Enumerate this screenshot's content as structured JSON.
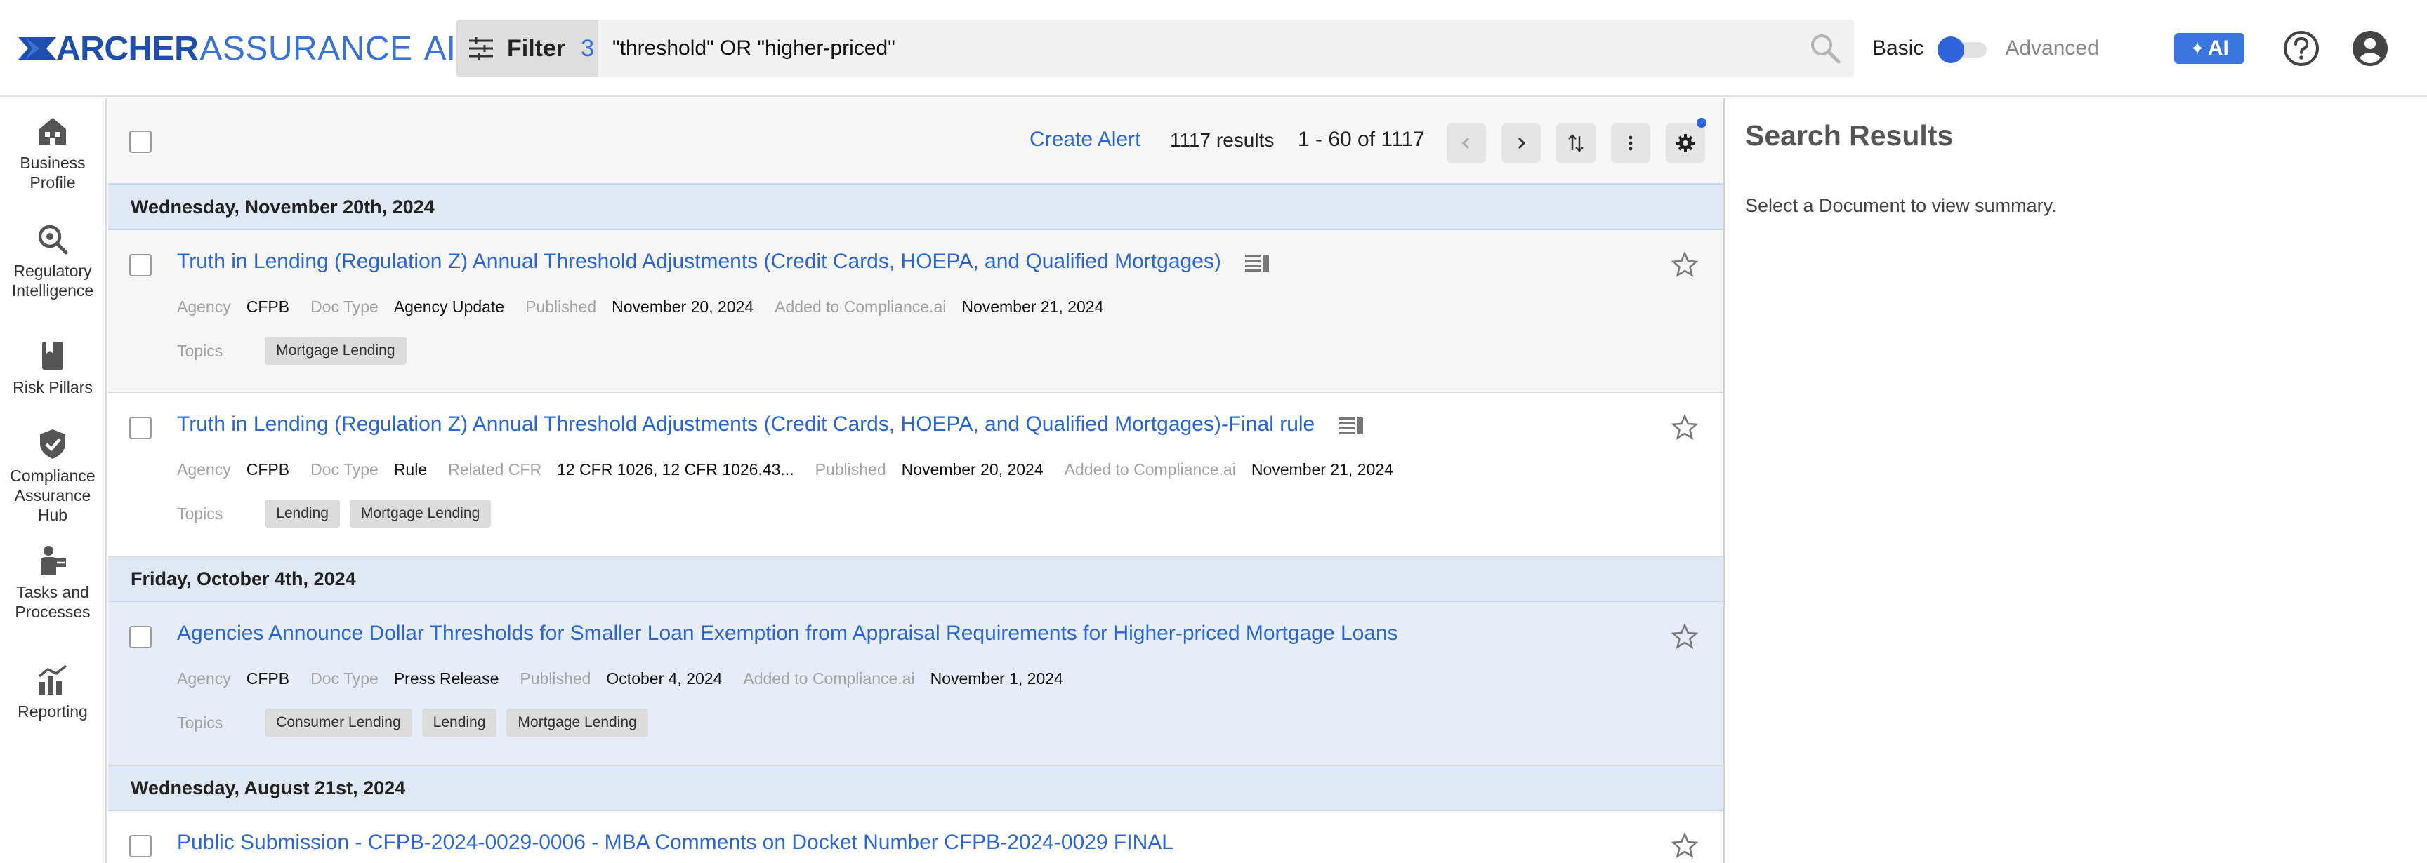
{
  "header": {
    "logo": {
      "word1": "ARCHER",
      "word2": "ASSURANCE",
      "word3": "AI"
    },
    "filter": {
      "label": "Filter",
      "count": "3"
    },
    "search": {
      "value": "\"threshold\" OR \"higher-priced\""
    },
    "mode": {
      "basic_label": "Basic",
      "advanced_label": "Advanced",
      "selected": "Basic"
    },
    "ai_button": {
      "label": "AI"
    },
    "icons": [
      "search-icon",
      "help-icon",
      "user-account-icon",
      "filter-sliders-icon"
    ]
  },
  "sidebar": {
    "items": [
      {
        "label": "Business\nProfile",
        "icon": "building-icon"
      },
      {
        "label": "Regulatory\nIntelligence",
        "icon": "magnifier-icon"
      },
      {
        "label": "Risk Pillars",
        "icon": "book-icon"
      },
      {
        "label": "Compliance\nAssurance\nHub",
        "icon": "shield-check-icon"
      },
      {
        "label": "Tasks and\nProcesses",
        "icon": "person-tasks-icon"
      },
      {
        "label": "Reporting",
        "icon": "chart-icon"
      }
    ]
  },
  "toolbar": {
    "create_alert": "Create Alert",
    "results_count": "1117 results",
    "range": "1 - 60 of 1117"
  },
  "groups": [
    {
      "date": "Wednesday, November 20th, 2024"
    },
    {
      "date": "Friday, October 4th, 2024"
    },
    {
      "date": "Wednesday, August 21st, 2024"
    }
  ],
  "results": [
    {
      "title": "Truth in Lending (Regulation Z) Annual Threshold Adjustments (Credit Cards, HOEPA, and Qualified Mortgages)",
      "meta": [
        {
          "k": "Agency",
          "v": "CFPB"
        },
        {
          "k": "Doc Type",
          "v": "Agency Update"
        },
        {
          "k": "Published",
          "v": "November 20, 2024"
        },
        {
          "k": "Added to Compliance.ai",
          "v": "November 21, 2024"
        }
      ],
      "topics_label": "Topics",
      "topics": [
        "Mortgage Lending"
      ]
    },
    {
      "title": "Truth in Lending (Regulation Z) Annual Threshold Adjustments (Credit Cards, HOEPA, and Qualified Mortgages)-Final rule",
      "meta": [
        {
          "k": "Agency",
          "v": "CFPB"
        },
        {
          "k": "Doc Type",
          "v": "Rule"
        },
        {
          "k": "Related CFR",
          "v": "12 CFR 1026, 12 CFR 1026.43..."
        },
        {
          "k": "Published",
          "v": "November 20, 2024"
        },
        {
          "k": "Added to Compliance.ai",
          "v": "November 21, 2024"
        }
      ],
      "topics_label": "Topics",
      "topics": [
        "Lending",
        "Mortgage Lending"
      ]
    },
    {
      "title": "Agencies Announce Dollar Thresholds for Smaller Loan Exemption from Appraisal Requirements for Higher-priced Mortgage Loans",
      "meta": [
        {
          "k": "Agency",
          "v": "CFPB"
        },
        {
          "k": "Doc Type",
          "v": "Press Release"
        },
        {
          "k": "Published",
          "v": "October 4, 2024"
        },
        {
          "k": "Added to Compliance.ai",
          "v": "November 1, 2024"
        }
      ],
      "topics_label": "Topics",
      "topics": [
        "Consumer Lending",
        "Lending",
        "Mortgage Lending"
      ]
    },
    {
      "title": "Public Submission - CFPB-2024-0029-0006 - MBA Comments on Docket Number CFPB-2024-0029 FINAL"
    }
  ],
  "right_panel": {
    "title": "Search Results",
    "subtitle": "Select a Document to view summary."
  },
  "colors": {
    "accent_blue": "#2b67d4",
    "logo_dark": "#1f4fa8",
    "selected_row": "#e4edf8",
    "date_row": "#dfe9f6"
  }
}
